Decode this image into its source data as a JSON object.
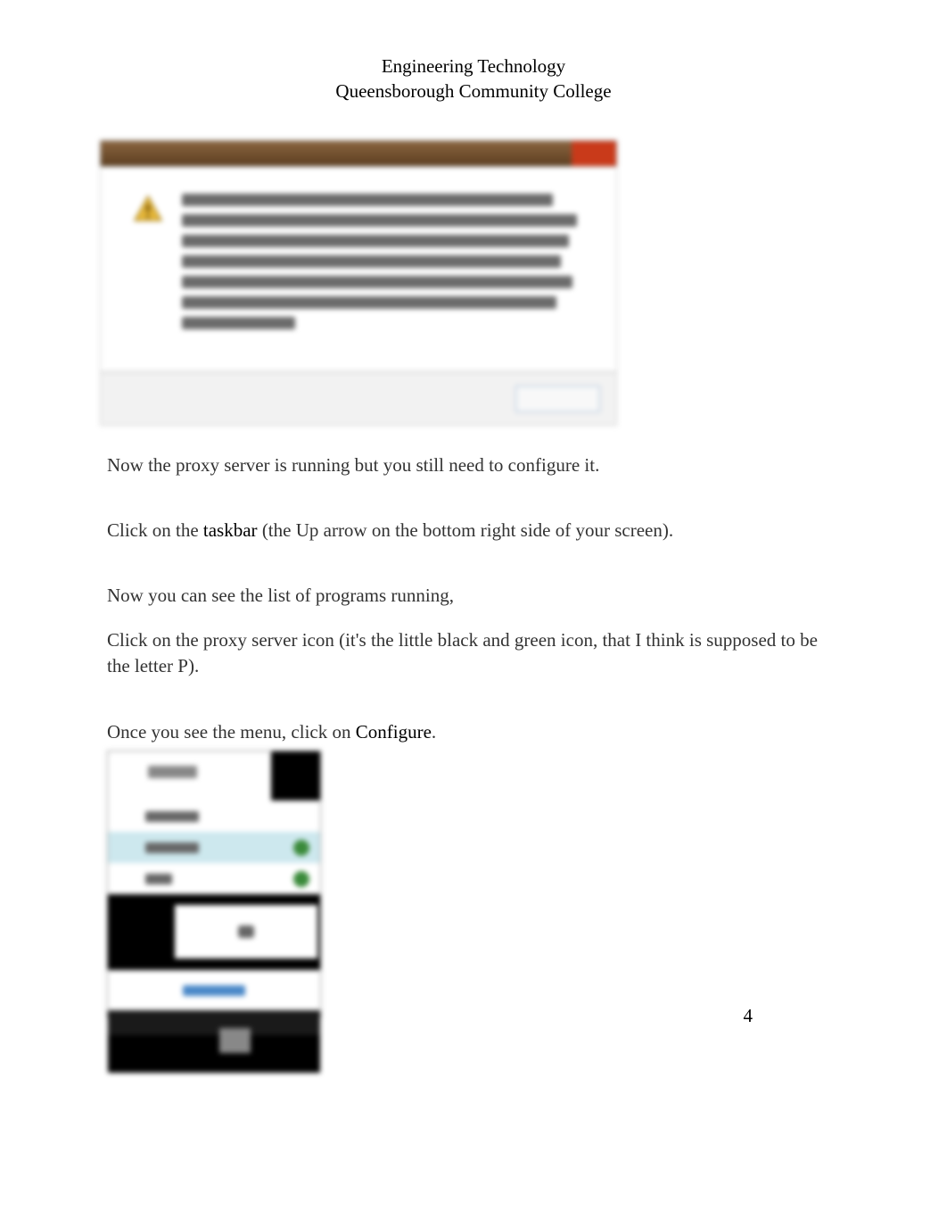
{
  "header": {
    "line1": "Engineering Technology",
    "line2": "Queensborough Community College"
  },
  "paragraphs": {
    "p1": "Now the proxy server is running but you still need to configure it.",
    "p2_a": "Click on the ",
    "p2_emph": "taskbar",
    "p2_b": " (the Up arrow on the bottom right side of your screen).",
    "p3": "Now you can see the list of programs running,",
    "p4": "Click on the proxy server icon (it's the little black and green icon, that I think is supposed to be the letter P).",
    "p5_a": "Once you see the menu, click on ",
    "p5_emph": "Configure",
    "p5_b": "."
  },
  "page_number": "4"
}
